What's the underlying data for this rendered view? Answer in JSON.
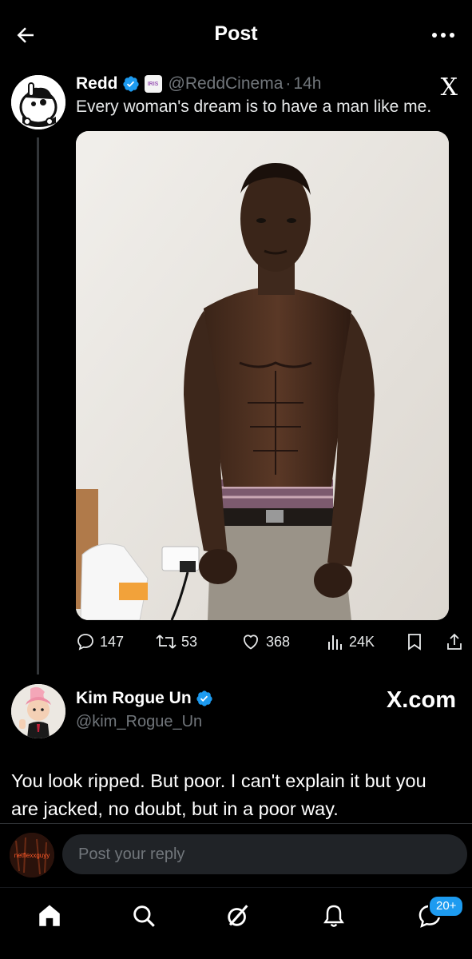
{
  "header": {
    "title": "Post",
    "back_icon": "arrow-left-icon",
    "more_icon": "more-horizontal-icon"
  },
  "post": {
    "author_name": "Redd",
    "affiliate_badge": "IRIS",
    "handle": "@ReddCinema",
    "separator": "·",
    "time": "14h",
    "text": "Every woman's dream is to have a man like me.",
    "watermark": "X",
    "stats": {
      "replies": "147",
      "reposts": "53",
      "likes": "368",
      "views": "24K"
    }
  },
  "reply": {
    "author_name": "Kim Rogue Un",
    "handle": "@kim_Rogue_Un",
    "watermark": "X.com",
    "text": "You look ripped. But poor. I can't explain it but you are jacked, no doubt,  but in a poor way."
  },
  "composer": {
    "avatar_label": "netflexxguyy",
    "placeholder": "Post your reply"
  },
  "nav": {
    "notifications_badge": "20+"
  },
  "colors": {
    "background": "#000000",
    "accent": "#1d9bf0",
    "secondary_text": "#71767b",
    "input_bg": "#202327"
  }
}
